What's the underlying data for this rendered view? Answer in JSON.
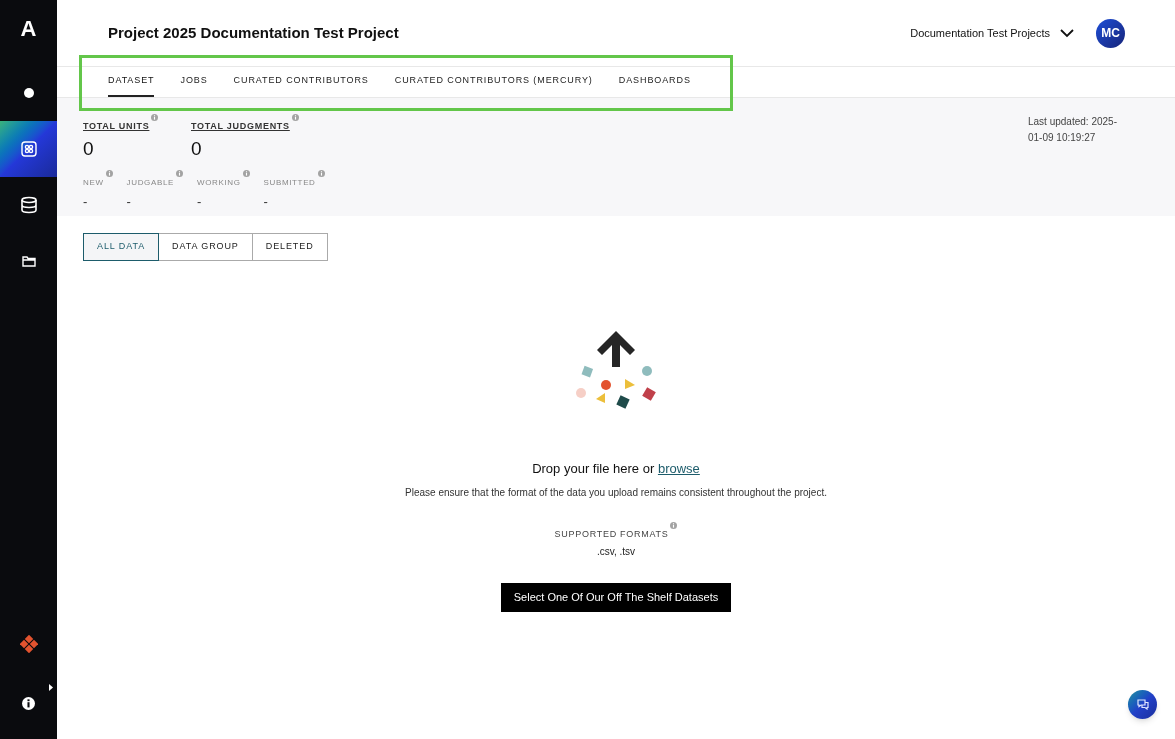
{
  "sidebar": {
    "logo": "A",
    "items": [
      {
        "kind": "dot",
        "selected": false
      },
      {
        "kind": "grid",
        "selected": true
      },
      {
        "kind": "database",
        "selected": false
      },
      {
        "kind": "folder",
        "selected": false
      }
    ]
  },
  "header": {
    "title": "Project 2025 Documentation Test Project",
    "team": "Documentation Test Projects",
    "avatar": "MC"
  },
  "tabs": [
    {
      "label": "DATASET",
      "selected": true
    },
    {
      "label": "JOBS",
      "selected": false
    },
    {
      "label": "CURATED CONTRIBUTORS",
      "selected": false
    },
    {
      "label": "CURATED CONTRIBUTORS (MERCURY)",
      "selected": false
    },
    {
      "label": "DASHBOARDS",
      "selected": false
    }
  ],
  "totals": [
    {
      "label": "TOTAL UNITS",
      "value": "0"
    },
    {
      "label": "TOTAL JUDGMENTS",
      "value": "0"
    }
  ],
  "counts": [
    {
      "label": "NEW",
      "value": "-"
    },
    {
      "label": "JUDGABLE",
      "value": "-"
    },
    {
      "label": "WORKING",
      "value": "-"
    },
    {
      "label": "SUBMITTED",
      "value": "-"
    }
  ],
  "last_updated": "Last updated: 2025-01-09 10:19:27",
  "filters": [
    {
      "label": "ALL DATA",
      "selected": true
    },
    {
      "label": "DATA GROUP",
      "selected": false
    },
    {
      "label": "DELETED",
      "selected": false
    }
  ],
  "upload": {
    "prompt": "Drop your file here or",
    "link": "browse",
    "note": "Please ensure that the format of the data you upload remains consistent throughout the project.",
    "formats_label": "SUPPORTED FORMATS",
    "formats": ".csv, .tsv",
    "button": "Select One Of Our Off The Shelf Datasets"
  }
}
